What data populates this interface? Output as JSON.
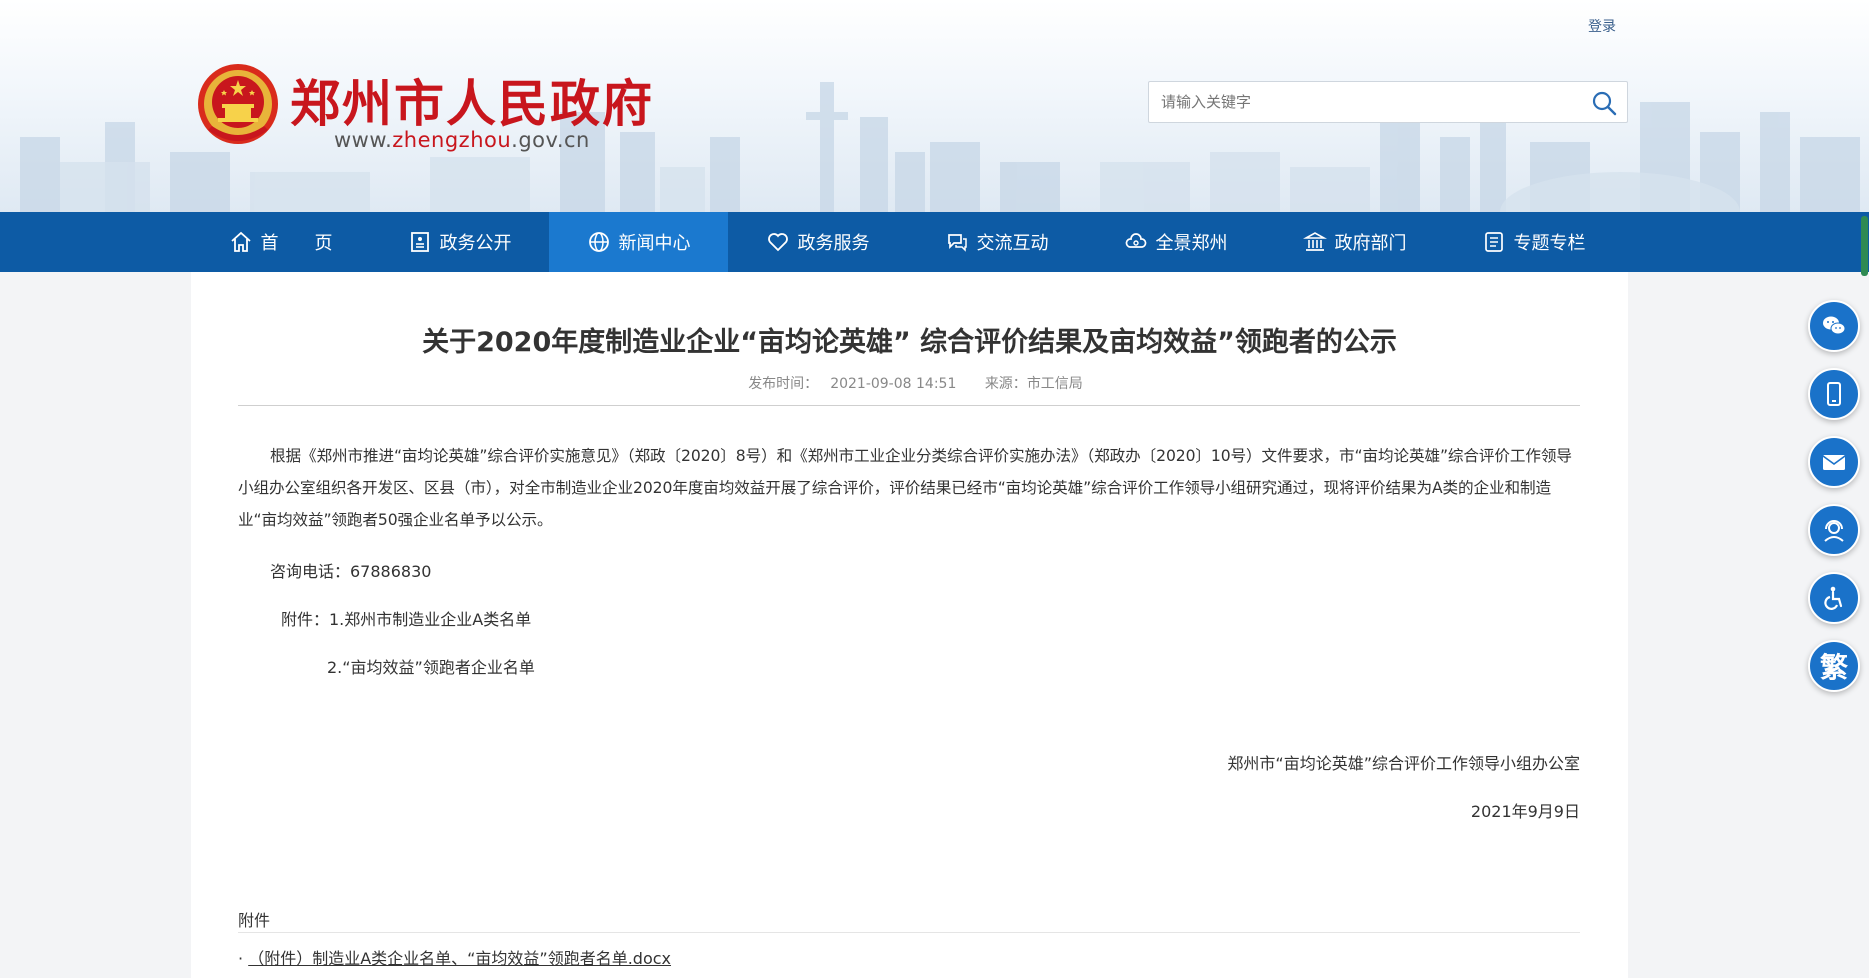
{
  "header": {
    "login": "登录",
    "site_title": "郑州市人民政府",
    "url_prefix": "www.",
    "url_highlight": "zhengzhou",
    "url_suffix": ".gov.cn",
    "search_placeholder": "请输入关键字",
    "colors": {
      "title": "#c8161d",
      "nav": "#0d5ba5",
      "nav_active": "#1b79cf"
    }
  },
  "nav": {
    "items": [
      {
        "label": "首　　页",
        "icon": "home-icon"
      },
      {
        "label": "政务公开",
        "icon": "document-icon"
      },
      {
        "label": "新闻中心",
        "icon": "globe-icon",
        "active": true
      },
      {
        "label": "政务服务",
        "icon": "heart-icon"
      },
      {
        "label": "交流互动",
        "icon": "chat-icon"
      },
      {
        "label": "全景郑州",
        "icon": "cloud-icon"
      },
      {
        "label": "政府部门",
        "icon": "building-icon"
      },
      {
        "label": "专题专栏",
        "icon": "list-icon"
      }
    ]
  },
  "article": {
    "title": "关于2020年度制造业企业“亩均论英雄” 综合评价结果及亩均效益”领跑者的公示",
    "publish_label": "发布时间：",
    "publish_time": "2021-09-08 14:51",
    "source_label": "来源：",
    "source": "市工信局",
    "body": "根据《郑州市推进“亩均论英雄”综合评价实施意见》（郑政〔2020〕8号）和《郑州市工业企业分类综合评价实施办法》（郑政办〔2020〕10号）文件要求，市“亩均论英雄”综合评价工作领导小组办公室组织各开发区、区县（市），对全市制造业企业2020年度亩均效益开展了综合评价，评价结果已经市“亩均论英雄”综合评价工作领导小组研究通过，现将评价结果为A类的企业和制造业“亩均效益”领跑者50强企业名单予以公示。",
    "contact": "咨询电话：67886830",
    "attachment_line1": "附件：1.郑州市制造业企业A类名单",
    "attachment_line2": "2.“亩均效益”领跑者企业名单",
    "signature": "郑州市“亩均论英雄”综合评价工作领导小组办公室",
    "date": "2021年9月9日",
    "attachments_heading": "附件",
    "attachment_bullet": "·",
    "attachment_file": "（附件）制造业A类企业名单、“亩均效益”领跑者名单.docx"
  },
  "float_toolbar": {
    "items": [
      "wechat-icon",
      "mobile-icon",
      "mail-icon",
      "service-icon",
      "accessibility-icon",
      "traditional-chinese-icon"
    ],
    "traditional_label": "繁"
  }
}
